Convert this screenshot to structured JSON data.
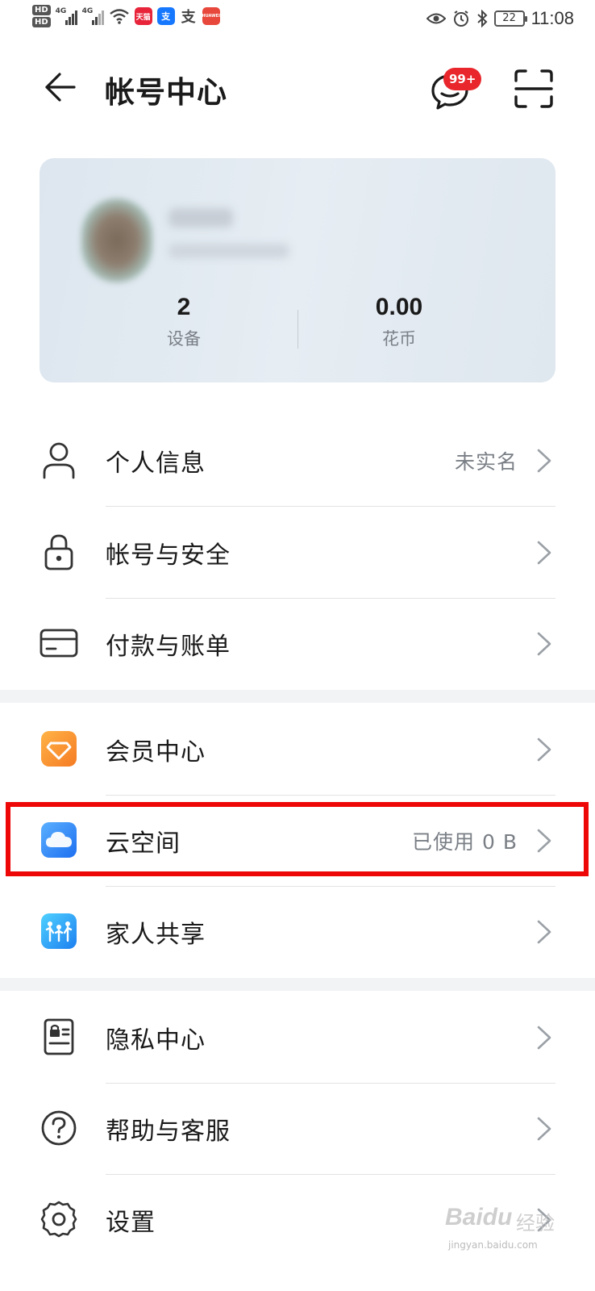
{
  "status_bar": {
    "hd1": "HD",
    "hd2": "HD",
    "net1": "4G",
    "net2": "4G",
    "app_tmall": "天猫",
    "app_alipay": "支",
    "app_alipay2": "支",
    "app_huawei": "HUAWEI",
    "battery": "22",
    "time": "11:08"
  },
  "header": {
    "title": "帐号中心",
    "message_badge": "99+"
  },
  "profile": {
    "devices_count": "2",
    "devices_label": "设备",
    "coins_value": "0.00",
    "coins_label": "花币"
  },
  "menu": {
    "group1": [
      {
        "label": "个人信息",
        "value": "未实名",
        "icon": "person-icon"
      },
      {
        "label": "帐号与安全",
        "value": "",
        "icon": "lock-icon"
      },
      {
        "label": "付款与账单",
        "value": "",
        "icon": "card-icon"
      }
    ],
    "group2": [
      {
        "label": "会员中心",
        "value": "",
        "icon": "diamond-icon"
      },
      {
        "label": "云空间",
        "value": "已使用 0 B",
        "icon": "cloud-icon"
      },
      {
        "label": "家人共享",
        "value": "",
        "icon": "family-icon"
      }
    ],
    "group3": [
      {
        "label": "隐私中心",
        "value": "",
        "icon": "privacy-icon"
      },
      {
        "label": "帮助与客服",
        "value": "",
        "icon": "help-icon"
      },
      {
        "label": "设置",
        "value": "",
        "icon": "gear-icon"
      }
    ]
  },
  "watermark": {
    "logo": "Baidu",
    "suffix": "经验",
    "url": "jingyan.baidu.com"
  },
  "colors": {
    "highlight": "#ee0707",
    "badge": "#e8262c",
    "card_bg": "#e2eaf1"
  }
}
